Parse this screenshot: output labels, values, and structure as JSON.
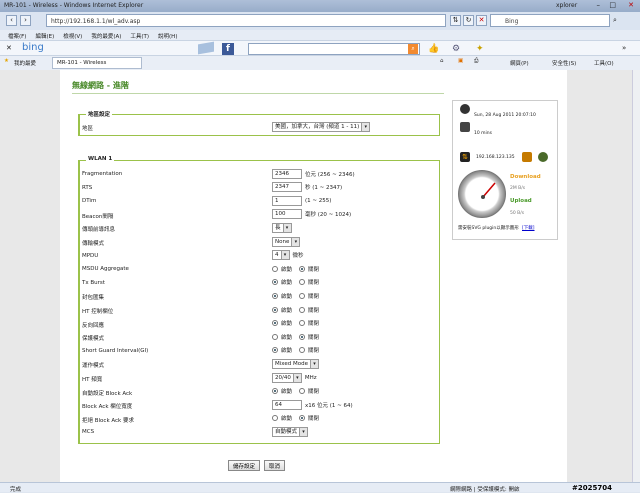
{
  "browser": {
    "title_left": "MR-101 - Wireless - Windows Internet Explorer",
    "title_right": "xplorer",
    "address": "http://192.168.1.1/wl_adv.asp",
    "search_placeholder": "Bing",
    "menu": [
      "檔案(F)",
      "編輯(E)",
      "檢視(V)",
      "我的最愛(A)",
      "工具(T)",
      "說明(H)"
    ],
    "favorites_label": "我的最愛",
    "tab_label": "MR-101 - Wireless",
    "right_tools": [
      "網頁(P)",
      "安全性(S)",
      "工具(O)"
    ],
    "bing_label": "bing",
    "status_left": "完成",
    "status_right": "網際網路 | 受保護模式: 開啟",
    "watermark": "#2025704"
  },
  "page": {
    "title": "無線網路 - 進階",
    "region_group": {
      "legend": "地區設定",
      "label": "地區",
      "value": "美國，加拿大，台灣 (頻道 1 - 11)"
    },
    "wlan_group": {
      "legend": "WLAN 1",
      "rows": [
        {
          "label": "Fragmentation",
          "type": "input",
          "value": "2346",
          "suffix": "位元 (256 ~ 2346)"
        },
        {
          "label": "RTS",
          "type": "input",
          "value": "2347",
          "suffix": "秒 (1 ~ 2347)"
        },
        {
          "label": "DTim",
          "type": "input",
          "value": "1",
          "suffix": "(1 ~ 255)"
        },
        {
          "label": "Beacon間隔",
          "type": "input",
          "value": "100",
          "suffix": "毫秒 (20 ~ 1024)"
        },
        {
          "label": "傳頭前導訊息",
          "type": "select",
          "value": "長",
          "suffix": ""
        },
        {
          "label": "傳輸模式",
          "type": "select",
          "value": "None",
          "suffix": ""
        },
        {
          "label": "MPDU",
          "type": "select",
          "value": "4",
          "suffix": "微秒"
        },
        {
          "label": "MSDU Aggregate",
          "type": "radio",
          "value": "關閉",
          "options": [
            "啟動",
            "關閉"
          ]
        },
        {
          "label": "Tx Burst",
          "type": "radio",
          "value": "啟動",
          "options": [
            "啟動",
            "關閉"
          ]
        },
        {
          "label": "封包匯集",
          "type": "radio",
          "value": "啟動",
          "options": [
            "啟動",
            "關閉"
          ]
        },
        {
          "label": "HT 控制欄位",
          "type": "radio",
          "value": "啟動",
          "options": [
            "啟動",
            "關閉"
          ]
        },
        {
          "label": "反向回應",
          "type": "radio",
          "value": "啟動",
          "options": [
            "啟動",
            "關閉"
          ]
        },
        {
          "label": "保護模式",
          "type": "radio",
          "value": "關閉",
          "options": [
            "啟動",
            "關閉"
          ]
        },
        {
          "label": "Short Guard Interval(GI)",
          "type": "radio",
          "value": "啟動",
          "options": [
            "啟動",
            "關閉"
          ]
        },
        {
          "label": "運作模式",
          "type": "select",
          "value": "Mixed Mode",
          "suffix": ""
        },
        {
          "label": "HT 頻寬",
          "type": "select",
          "value": "20/40",
          "suffix": "MHz"
        },
        {
          "label": "自動設定 Block Ack",
          "type": "radio",
          "value": "啟動",
          "options": [
            "啟動",
            "關閉"
          ]
        },
        {
          "label": "Block Ack 欄位寬度",
          "type": "input",
          "value": "64",
          "suffix": "x16 位元 (1 ~ 64)"
        },
        {
          "label": "拒絕 Block Ack 要求",
          "type": "radio",
          "value": "關閉",
          "options": [
            "啟動",
            "關閉"
          ]
        },
        {
          "label": "MCS",
          "type": "select",
          "value": "自動模式",
          "suffix": ""
        }
      ]
    },
    "save_label": "儲存設定",
    "cancel_label": "取消"
  },
  "sidebar": {
    "datetime": "Sun, 28 Aug 2011 20:07:10",
    "uptime": "10 mins",
    "ip": "192.168.123.135",
    "download_label": "Download",
    "upload_label": "Upload",
    "download_rate": "2M B/s",
    "upload_rate": "50 B/s",
    "gauge_labels": [
      "0",
      "10",
      "100",
      "1M",
      "10M"
    ],
    "footer_text": "需安裝SVG plugin以顯示圖形",
    "footer_link": "[下載]",
    "accent_download": "#e8a020",
    "accent_upload": "#4a9a2a"
  }
}
